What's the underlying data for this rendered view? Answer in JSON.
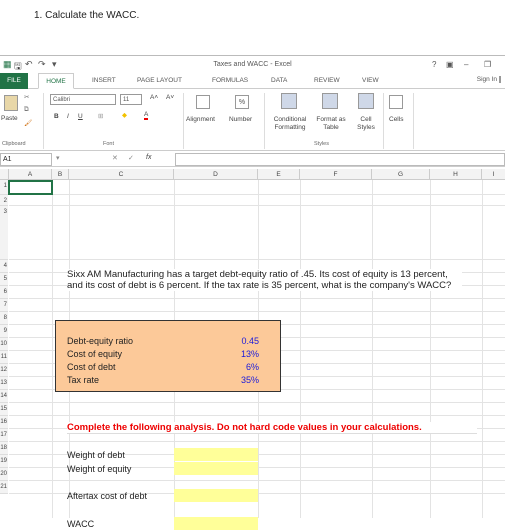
{
  "question": "1. Calculate the WACC.",
  "excel": {
    "title": "Taxes and WACC - Excel",
    "tabs": [
      "FILE",
      "HOME",
      "INSERT",
      "PAGE LAYOUT",
      "FORMULAS",
      "DATA",
      "REVIEW",
      "VIEW"
    ],
    "sign_in": "Sign In",
    "ribbon": {
      "paste": "Paste",
      "font_name": "Calibri",
      "font_size": "11",
      "alignment": "Alignment",
      "number": "Number",
      "conditional_formatting": "Conditional Formatting",
      "format_as_table": "Format as Table",
      "cell_styles": "Cell Styles",
      "cells": "Cells",
      "groups": {
        "clipboard": "Clipboard",
        "font": "Font",
        "styles": "Styles"
      }
    },
    "name_box": "A1",
    "fx": "fx",
    "columns": [
      "A",
      "B",
      "C",
      "D",
      "E",
      "F",
      "G",
      "H",
      "I"
    ],
    "rows": [
      "1",
      "2",
      "3",
      "4",
      "5",
      "6",
      "7",
      "8",
      "9",
      "10",
      "11",
      "12",
      "13",
      "14",
      "15",
      "16",
      "17",
      "18",
      "19",
      "20",
      "21"
    ]
  },
  "sheet": {
    "problem": "Sixx AM Manufacturing has a target debt-equity ratio of .45. Its cost of equity is 13 percent, and its cost of debt is 6 percent. If the tax rate is 35 percent, what is the company's WACC?",
    "inputs": [
      {
        "label": "Debt-equity ratio",
        "value": "0.45"
      },
      {
        "label": "Cost of equity",
        "value": "13%"
      },
      {
        "label": "Cost of debt",
        "value": "6%"
      },
      {
        "label": "Tax rate",
        "value": "35%"
      }
    ],
    "instruction": "Complete the following analysis. Do not hard code values in your calculations.",
    "analysis": [
      {
        "label": "Weight of debt"
      },
      {
        "label": "Weight of equity"
      },
      {
        "label": "Aftertax cost of debt"
      },
      {
        "label": "WACC"
      }
    ]
  },
  "colors": {
    "excel_green": "#217346",
    "input_fill": "#fcc999",
    "answer_fill": "#ffff99",
    "value_blue": "#1a1adb",
    "instruction_red": "#e00000"
  }
}
